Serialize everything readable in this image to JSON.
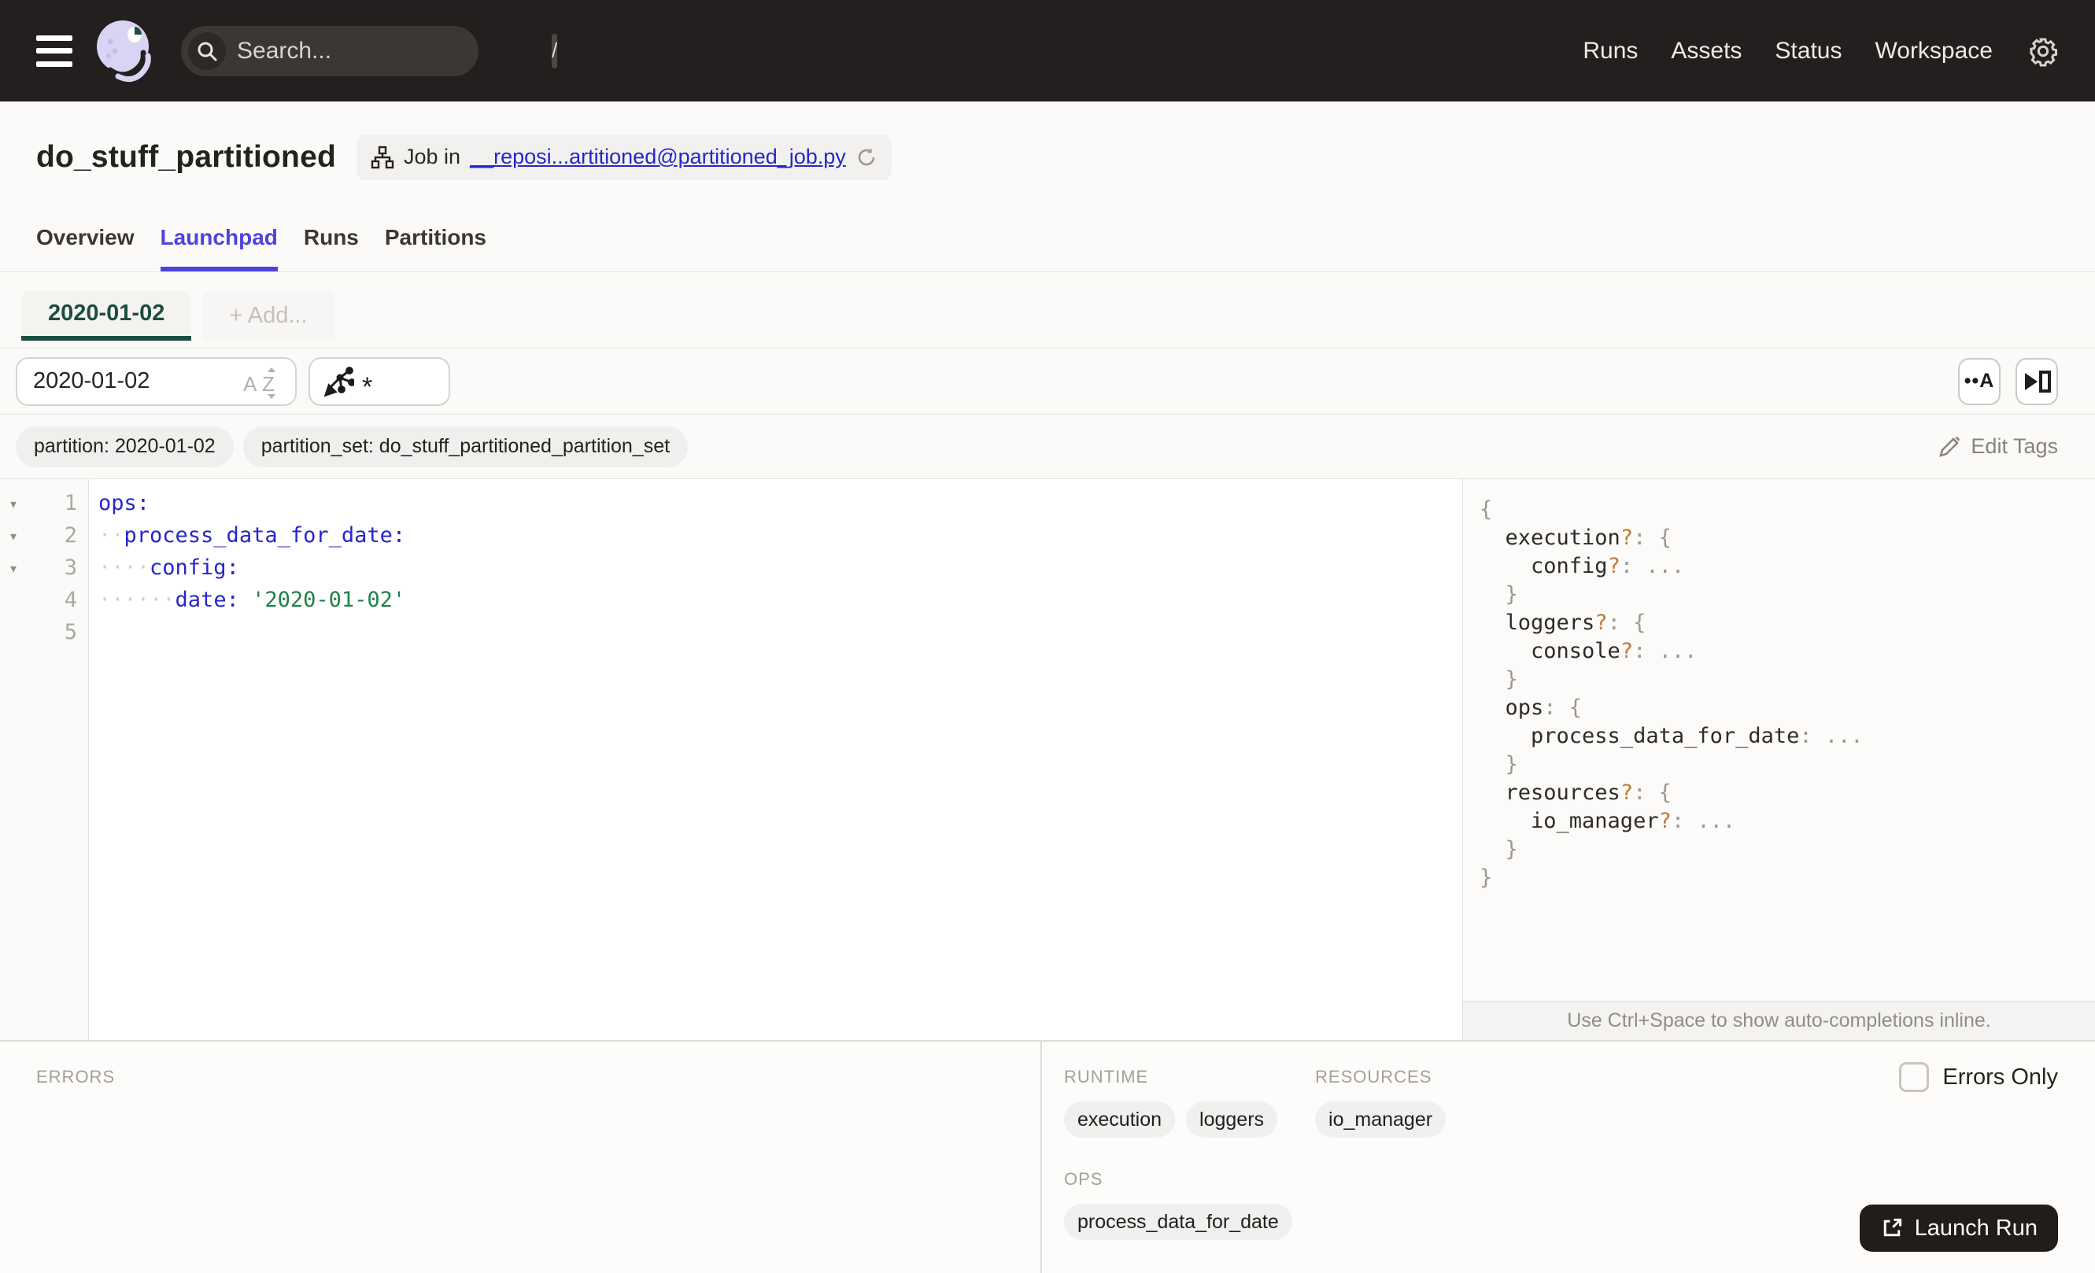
{
  "nav": {
    "search_placeholder": "Search...",
    "search_shortcut": "/",
    "links": [
      "Runs",
      "Assets",
      "Status",
      "Workspace"
    ]
  },
  "header": {
    "title": "do_stuff_partitioned",
    "job_badge_prefix": "Job in",
    "job_badge_link": "__reposi...artitioned@partitioned_job.py",
    "tabs": [
      {
        "label": "Overview",
        "active": false
      },
      {
        "label": "Launchpad",
        "active": true
      },
      {
        "label": "Runs",
        "active": false
      },
      {
        "label": "Partitions",
        "active": false
      }
    ]
  },
  "launchpad": {
    "config_tab": "2020-01-02",
    "add_tab_label": "+ Add...",
    "partition_input_value": "2020-01-02",
    "op_selector_value": "*",
    "tags": [
      "partition: 2020-01-02",
      "partition_set: do_stuff_partitioned_partition_set"
    ],
    "edit_tags_label": "Edit Tags"
  },
  "editor": {
    "lines": [
      {
        "num": "1",
        "fold": true,
        "segments": [
          {
            "t": "ops:",
            "c": "key"
          }
        ]
      },
      {
        "num": "2",
        "fold": true,
        "segments": [
          {
            "t": "··",
            "c": "ws"
          },
          {
            "t": "process_data_for_date:",
            "c": "key"
          }
        ]
      },
      {
        "num": "3",
        "fold": true,
        "segments": [
          {
            "t": "····",
            "c": "ws"
          },
          {
            "t": "config:",
            "c": "key"
          }
        ]
      },
      {
        "num": "4",
        "fold": false,
        "segments": [
          {
            "t": "······",
            "c": "ws"
          },
          {
            "t": "date:",
            "c": "key"
          },
          {
            "t": " ",
            "c": "plain"
          },
          {
            "t": "'2020-01-02'",
            "c": "str"
          }
        ]
      },
      {
        "num": "5",
        "fold": false,
        "segments": []
      }
    ]
  },
  "schema": {
    "lines": [
      [
        {
          "t": "{",
          "c": "p"
        }
      ],
      [
        {
          "t": "  execution",
          "c": "skey"
        },
        {
          "t": "?",
          "c": "q"
        },
        {
          "t": ":",
          "c": "p"
        },
        {
          "t": " {",
          "c": "p"
        }
      ],
      [
        {
          "t": "    config",
          "c": "skey"
        },
        {
          "t": "?",
          "c": "q"
        },
        {
          "t": ":",
          "c": "p"
        },
        {
          "t": " ...",
          "c": "p"
        }
      ],
      [
        {
          "t": "  }",
          "c": "p"
        }
      ],
      [
        {
          "t": "  loggers",
          "c": "skey"
        },
        {
          "t": "?",
          "c": "q"
        },
        {
          "t": ":",
          "c": "p"
        },
        {
          "t": " {",
          "c": "p"
        }
      ],
      [
        {
          "t": "    console",
          "c": "skey"
        },
        {
          "t": "?",
          "c": "q"
        },
        {
          "t": ":",
          "c": "p"
        },
        {
          "t": " ...",
          "c": "p"
        }
      ],
      [
        {
          "t": "  }",
          "c": "p"
        }
      ],
      [
        {
          "t": "  ops",
          "c": "skey"
        },
        {
          "t": ":",
          "c": "p"
        },
        {
          "t": " {",
          "c": "p"
        }
      ],
      [
        {
          "t": "    process_data_for_date",
          "c": "skey"
        },
        {
          "t": ":",
          "c": "p"
        },
        {
          "t": " ...",
          "c": "p"
        }
      ],
      [
        {
          "t": "  }",
          "c": "p"
        }
      ],
      [
        {
          "t": "  resources",
          "c": "skey"
        },
        {
          "t": "?",
          "c": "q"
        },
        {
          "t": ":",
          "c": "p"
        },
        {
          "t": " {",
          "c": "p"
        }
      ],
      [
        {
          "t": "    io_manager",
          "c": "skey"
        },
        {
          "t": "?",
          "c": "q"
        },
        {
          "t": ":",
          "c": "p"
        },
        {
          "t": " ...",
          "c": "p"
        }
      ],
      [
        {
          "t": "  }",
          "c": "p"
        }
      ],
      [
        {
          "t": "}",
          "c": "p"
        }
      ]
    ],
    "footer": "Use Ctrl+Space to show auto-completions inline."
  },
  "bottom": {
    "errors_label": "ERRORS",
    "runtime_label": "RUNTIME",
    "runtime_chips": [
      "execution",
      "loggers"
    ],
    "resources_label": "RESOURCES",
    "resources_chips": [
      "io_manager"
    ],
    "ops_label": "OPS",
    "ops_chips": [
      "process_data_for_date"
    ],
    "errors_only_label": "Errors Only",
    "launch_button_label": "Launch Run"
  },
  "colors": {
    "nav_bg": "#231F1E",
    "accent_blurple": "#4F43DD",
    "partition_green": "#1C4D40",
    "link_blue": "#2626CB",
    "yaml_key_blue": "#2525CE",
    "yaml_string_green": "#1F8149",
    "optional_marker_orange": "#BE7A35",
    "launch_button_bg": "#201D1B"
  }
}
